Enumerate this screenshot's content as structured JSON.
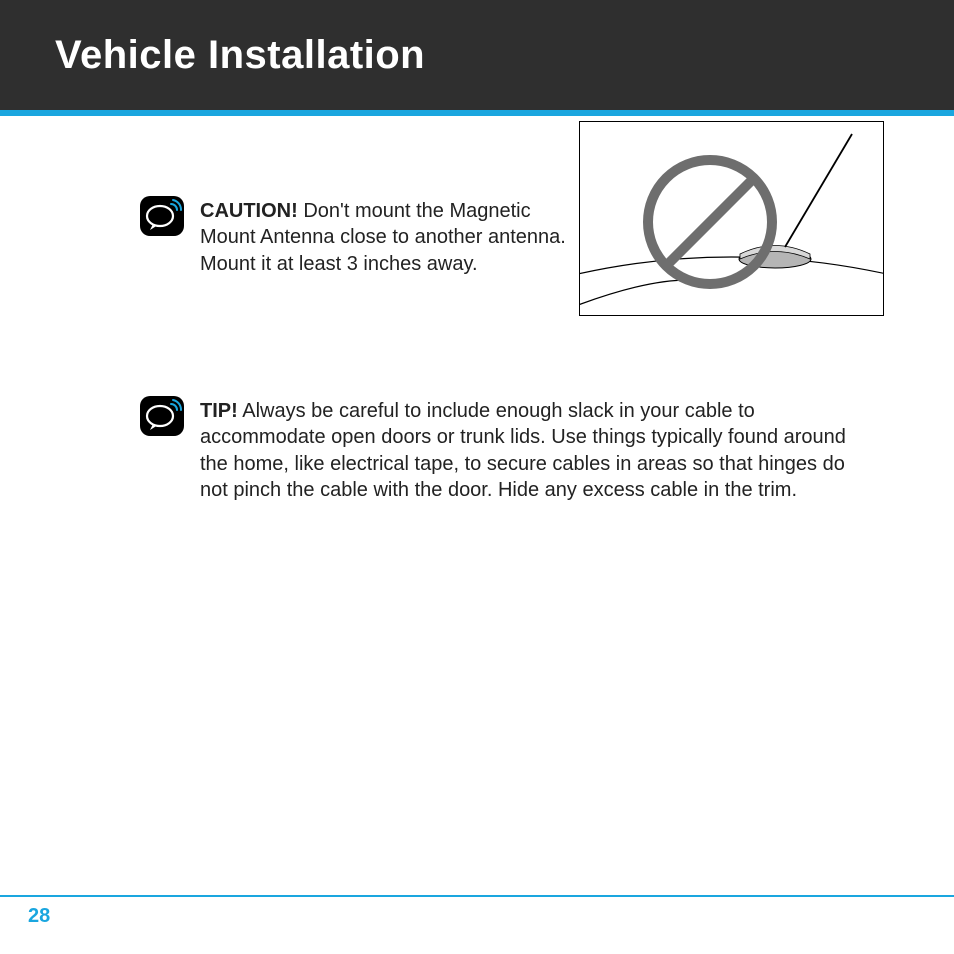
{
  "header": {
    "title": "Vehicle Installation"
  },
  "caution": {
    "label": "CAUTION!",
    "text": " Don't mount the Magnetic Mount Antenna close to another antenna. Mount it at least 3 inches away."
  },
  "tip": {
    "label": "TIP!",
    "text": " Always be careful to include enough slack in your cable to accommodate open doors or trunk lids. Use things typically found around the home, like electrical tape, to secure cables in areas so that hinges do not pinch the cable with the door. Hide any excess cable in the trim."
  },
  "page_number": "28",
  "colors": {
    "accent": "#1aa6df",
    "header_bg": "#2f2f2f"
  }
}
